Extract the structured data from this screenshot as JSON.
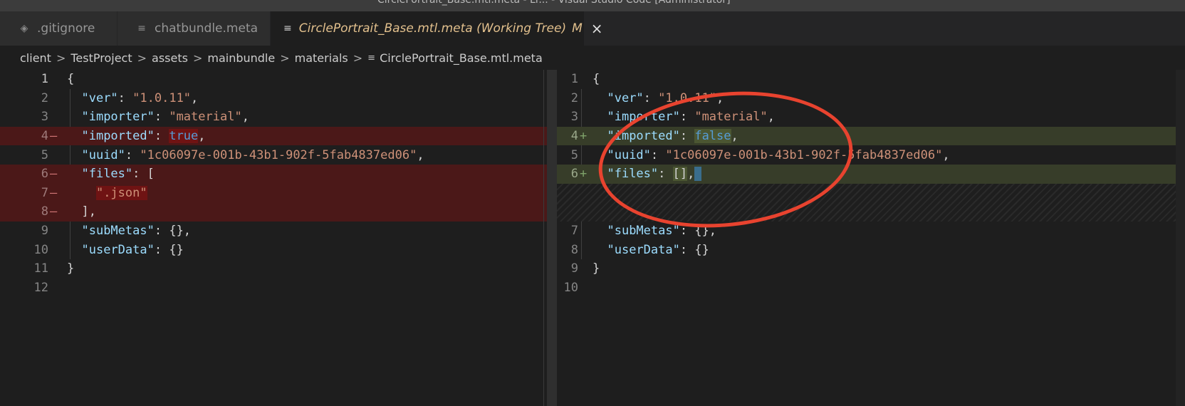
{
  "window": {
    "title": "CirclePortrait_Base.mtl.meta - Lr... - Visual Studio Code [Administrator]"
  },
  "tabs": [
    {
      "label": ".gitignore",
      "icon": "diamond-icon",
      "active": false
    },
    {
      "label": "chatbundle.meta",
      "icon": "lines-icon",
      "active": false
    },
    {
      "label": "CirclePortrait_Base.mtl.meta (Working Tree)",
      "icon": "lines-icon",
      "active": true,
      "badge": "M",
      "close": "×"
    }
  ],
  "breadcrumb": [
    "client",
    "TestProject",
    "assets",
    "mainbundle",
    "materials",
    "CirclePortrait_Base.mtl.meta"
  ],
  "breadcrumb_sep": ">",
  "left_pane": {
    "line_numbers": [
      "1",
      "2",
      "3",
      "4",
      "5",
      "6",
      "7",
      "8",
      "9",
      "10",
      "11",
      "12"
    ],
    "removed_lines": [
      4,
      6,
      7,
      8
    ],
    "code": {
      "l1": "{",
      "l2_key": "\"ver\"",
      "l2_val": "\"1.0.11\"",
      "l3_key": "\"importer\"",
      "l3_val": "\"material\"",
      "l4_key": "\"imported\"",
      "l4_val": "true",
      "l5_key": "\"uuid\"",
      "l5_val": "\"1c06097e-001b-43b1-902f-5fab4837ed06\"",
      "l6_key": "\"files\"",
      "l6_val": "[",
      "l7_val": "\".json\"",
      "l8": "],",
      "l9_key": "\"subMetas\"",
      "l9_val": "{},",
      "l10_key": "\"userData\"",
      "l10_val": "{}",
      "l11": "}"
    }
  },
  "right_pane": {
    "line_numbers": [
      "1",
      "2",
      "3",
      "4",
      "5",
      "6",
      "7",
      "8",
      "9",
      "10"
    ],
    "added_lines": [
      4,
      6
    ],
    "code": {
      "l1": "{",
      "l2_key": "\"ver\"",
      "l2_val": "\"1.0.11\"",
      "l3_key": "\"importer\"",
      "l3_val": "\"material\"",
      "l4_key": "\"imported\"",
      "l4_val": "false",
      "l5_key": "\"uuid\"",
      "l5_val": "\"1c06097e-001b-43b1-902f-5fab4837ed06\"",
      "l6_key": "\"files\"",
      "l6_val": "[]",
      "l7_key": "\"subMetas\"",
      "l7_val": "{},",
      "l8_key": "\"userData\"",
      "l8_val": "{}",
      "l9": "}"
    }
  },
  "diff_markers": {
    "removed": "—",
    "added": "+"
  },
  "colors": {
    "removed_bg": "#4b1818",
    "added_bg": "#373d29",
    "annotation_circle": "#e8432f",
    "modified_tab_text": "#e2c08d"
  }
}
